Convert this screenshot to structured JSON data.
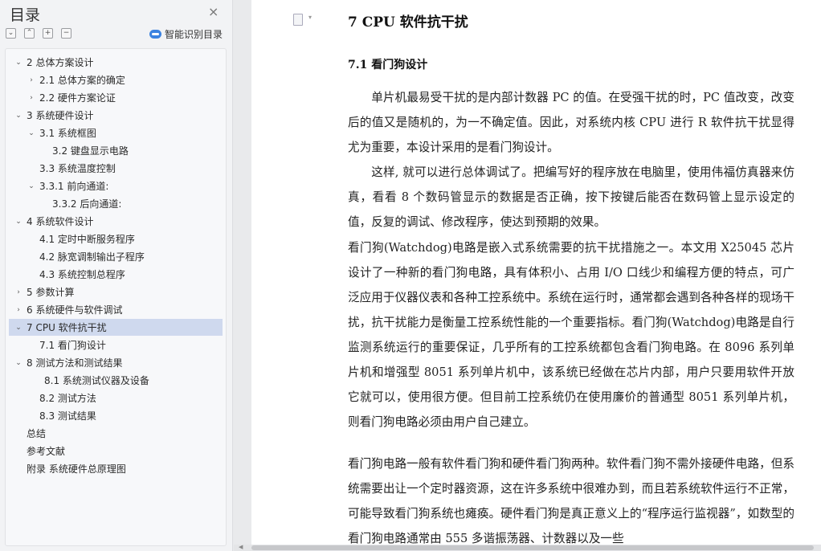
{
  "nav": {
    "title": "目录",
    "close_glyph": "×",
    "tools": [
      "⌄",
      "⌃",
      "+",
      "−"
    ],
    "smart_label": "智能识别目录",
    "items": [
      {
        "label": "2  总体方案设计",
        "chev": "⌄",
        "sel": false
      },
      {
        "label": "2.1 总体方案的确定",
        "chev": "›",
        "sel": false
      },
      {
        "label": "2.2  硬件方案论证",
        "chev": "›",
        "sel": false
      },
      {
        "label": "3    系统硬件设计",
        "chev": "⌄",
        "sel": false
      },
      {
        "label": "3.1 系统框图",
        "chev": "⌄",
        "sel": false
      },
      {
        "label": "3.2  键盘显示电路",
        "chev": "",
        "sel": false
      },
      {
        "label": "3.3 系统温度控制",
        "chev": "",
        "sel": false
      },
      {
        "label": "3.3.1 前向通道:",
        "chev": "⌄",
        "sel": false
      },
      {
        "label": "3.3.2  后向通道:",
        "chev": "",
        "sel": false
      },
      {
        "label": "4  系统软件设计",
        "chev": "⌄",
        "sel": false
      },
      {
        "label": "4.1 定时中断服务程序",
        "chev": "",
        "sel": false
      },
      {
        "label": "4.2 脉宽调制输出子程序",
        "chev": "",
        "sel": false
      },
      {
        "label": "4.3  系统控制总程序",
        "chev": "",
        "sel": false
      },
      {
        "label": "5    参数计算",
        "chev": "›",
        "sel": false
      },
      {
        "label": "6  系统硬件与软件调试",
        "chev": "›",
        "sel": false
      },
      {
        "label": "7    CPU 软件抗干扰",
        "chev": "⌄",
        "sel": true
      },
      {
        "label": "7.1    看门狗设计",
        "chev": "",
        "sel": false
      },
      {
        "label": "8    测试方法和测试结果",
        "chev": "⌄",
        "sel": false
      },
      {
        "label": "8.1    系统测试仪器及设备",
        "chev": "",
        "sel": false
      },
      {
        "label": "8.2    测试方法",
        "chev": "",
        "sel": false
      },
      {
        "label": "8.3    测试结果",
        "chev": "",
        "sel": false
      },
      {
        "label": "总结",
        "chev": "",
        "sel": false
      },
      {
        "label": "参考文献",
        "chev": "",
        "sel": false
      },
      {
        "label": "附录  系统硬件总原理图",
        "chev": "",
        "sel": false
      }
    ]
  },
  "doc": {
    "h1": "7   CPU 软件抗干扰",
    "h2": "7.1    看门狗设计",
    "p1": "单片机最易受干扰的是内部计数器 PC 的值。在受强干扰的时，PC 值改变，改变后的值又是随机的，为一不确定值。因此，对系统内核 CPU 进行 R 软件抗干扰显得尤为重要，本设计采用的是看门狗设计。",
    "p2": "这样, 就可以进行总体调试了。把编写好的程序放在电脑里，使用伟福仿真器来仿真，看看 8 个数码管显示的数据是否正确，按下按键后能否在数码管上显示设定的值，反复的调试、修改程序，使达到预期的效果。",
    "p3": "看门狗(Watchdog)电路是嵌入式系统需要的抗干扰措施之一。本文用 X25045 芯片设计了一种新的看门狗电路，具有体积小、占用 I/O 口线少和编程方便的特点，可广泛应用于仪器仪表和各种工控系统中。系统在运行时，通常都会遇到各种各样的现场干扰，抗干扰能力是衡量工控系统性能的一个重要指标。看门狗(Watchdog)电路是自行监测系统运行的重要保证，几乎所有的工控系统都包含看门狗电路。在 8096 系列单片机和增强型 8051 系列单片机中，该系统已经做在芯片内部，用户只要用软件开放它就可以，使用很方便。但目前工控系统仍在使用廉价的普通型 8051 系列单片机，则看门狗电路必须由用户自己建立。",
    "p4": "看门狗电路一般有软件看门狗和硬件看门狗两种。软件看门狗不需外接硬件电路，但系统需要出让一个定时器资源，这在许多系统中很难办到，而且若系统软件运行不正常，可能导致看门狗系统也瘫痪。硬件看门狗是真正意义上的“程序运行监视器”，如数型的看门狗电路通常由 555 多谐振荡器、计数器以及一些"
  },
  "scroll": {
    "left_arrow": "◀"
  }
}
